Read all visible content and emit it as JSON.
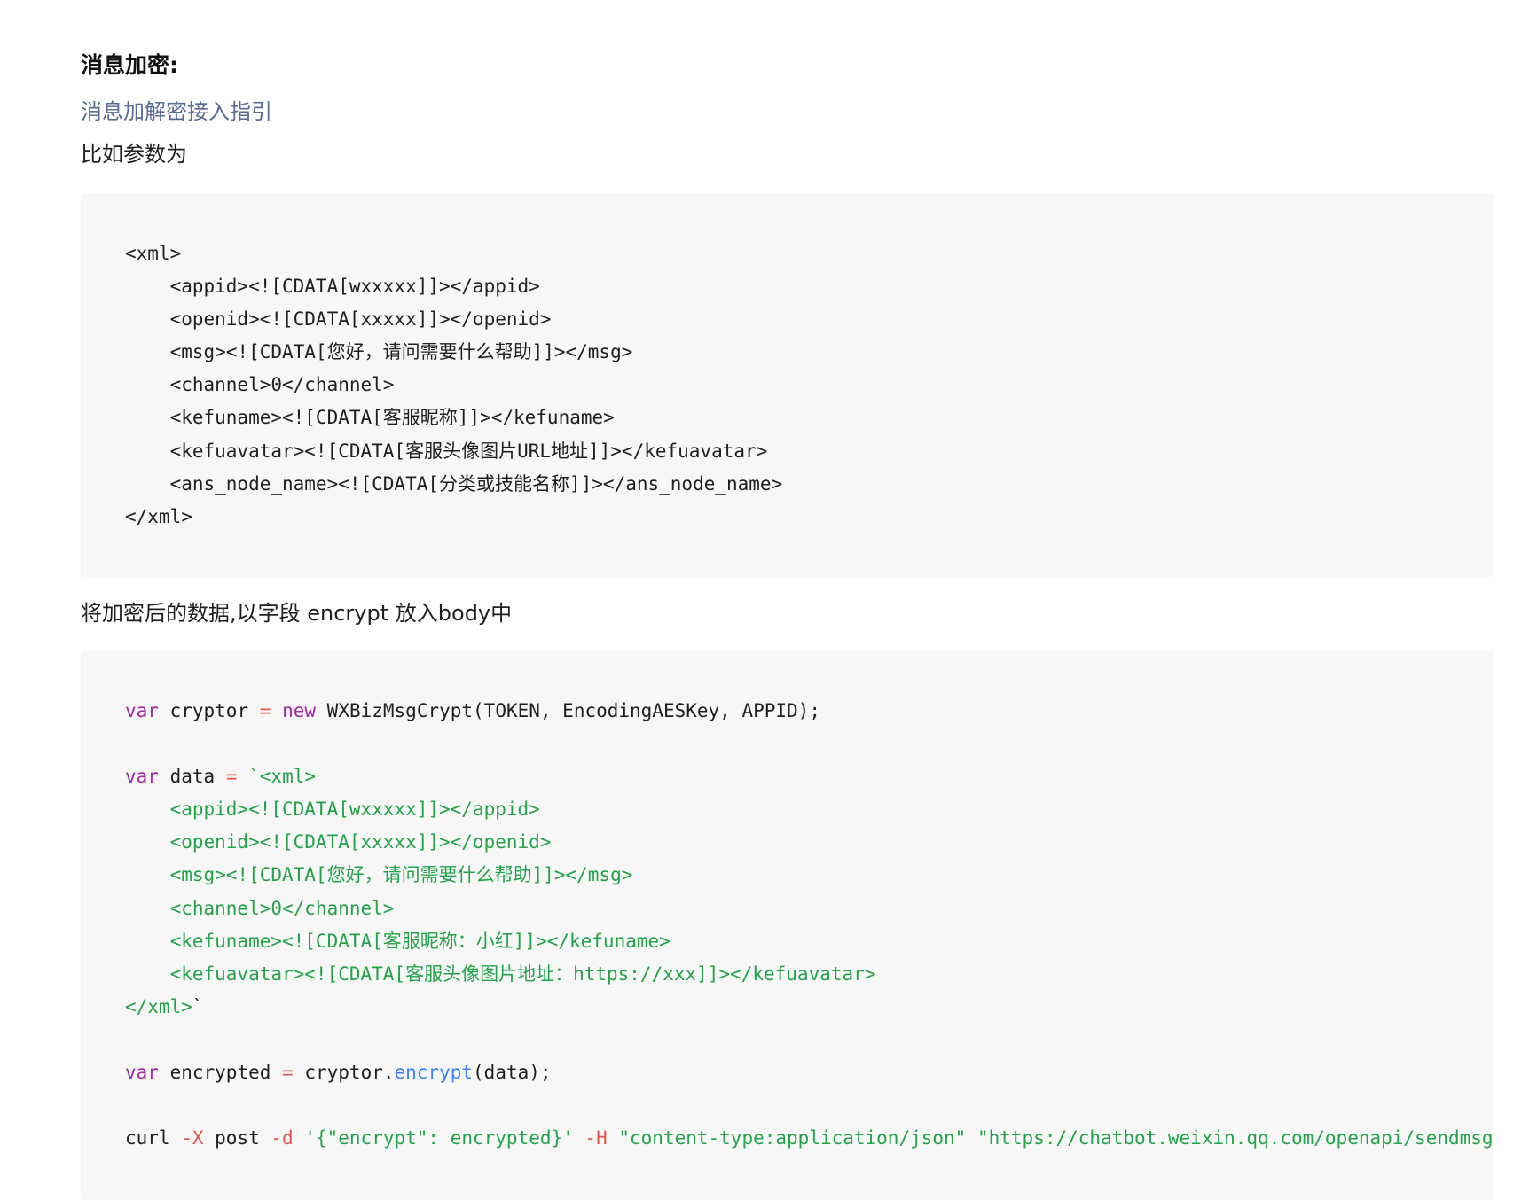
{
  "heading": "消息加密:",
  "guide_link": "消息加解密接入指引",
  "intro_text": "比如参数为",
  "xml_example": {
    "lines": [
      "<xml>",
      "    <appid><![CDATA[wxxxxx]]></appid>",
      "    <openid><![CDATA[xxxxx]]></openid>",
      "    <msg><![CDATA[您好，请问需要什么帮助]]></msg>",
      "    <channel>0</channel>",
      "    <kefuname><![CDATA[客服昵称]]></kefuname>",
      "    <kefuavatar><![CDATA[客服头像图片URL地址]]></kefuavatar>",
      "    <ans_node_name><![CDATA[分类或技能名称]]></ans_node_name>",
      "</xml>"
    ]
  },
  "body_text": "将加密后的数据,以字段 encrypt 放入body中",
  "js_example": {
    "kw_var": "var",
    "kw_new": "new",
    "op_assign": "=",
    "line1_name": "cryptor",
    "line1_call": "WXBizMsgCrypt(TOKEN, EncodingAESKey, APPID);",
    "line2_name": "data",
    "xml_lines": [
      "`<xml>",
      "    <appid><![CDATA[wxxxxx]]></appid>",
      "    <openid><![CDATA[xxxxx]]></openid>",
      "    <msg><![CDATA[您好，请问需要什么帮助]]></msg>",
      "    <channel>0</channel>",
      "    <kefuname><![CDATA[客服昵称：小红]]></kefuname>",
      "    <kefuavatar><![CDATA[客服头像图片地址：https://xxx]]></kefuavatar>",
      "</xml>"
    ],
    "xml_close_tick": "`",
    "line3_name": "encrypted",
    "line3_obj": "cryptor.",
    "line3_method": "encrypt",
    "line3_args": "(data);",
    "curl_cmd": "curl ",
    "curl_flag_x": "-X",
    "curl_method": " post ",
    "curl_flag_d": "-d",
    "curl_data": "'{\"encrypt\": encrypted}'",
    "curl_flag_h": "-H",
    "curl_header": "\"content-type:application/json\"",
    "curl_url": "\"https://chatbot.weixin.qq.com/openapi/sendmsg\""
  }
}
